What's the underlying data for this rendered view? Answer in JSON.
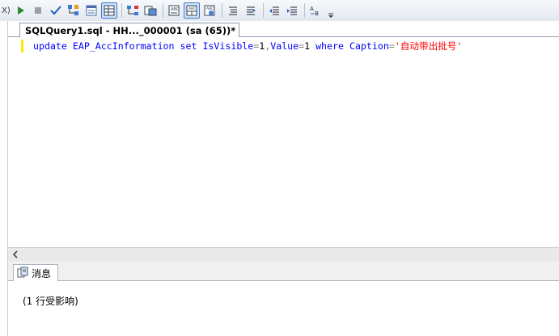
{
  "toolbar": {
    "partial_label": "X)",
    "buttons": [
      {
        "name": "execute-icon"
      },
      {
        "name": "stop-icon"
      },
      {
        "name": "parse-check-icon"
      },
      {
        "name": "display-estimated-plan-icon"
      },
      {
        "name": "query-designer-icon"
      },
      {
        "name": "results-to-grid-icon",
        "active": true
      },
      {
        "name": "include-actual-plan-icon"
      },
      {
        "name": "client-statistics-icon"
      },
      {
        "name": "results-to-text-icon"
      },
      {
        "name": "results-to-grid-2-icon",
        "active": true
      },
      {
        "name": "results-to-file-icon"
      },
      {
        "name": "comment-lines-icon"
      },
      {
        "name": "uncomment-lines-icon"
      },
      {
        "name": "decrease-indent-icon"
      },
      {
        "name": "increase-indent-icon"
      },
      {
        "name": "specify-template-values-icon"
      }
    ]
  },
  "editor": {
    "tab_title": "SQLQuery1.sql - HH..._000001 (sa (65))*",
    "code": {
      "t1": "update",
      "t2": "EAP_AccInformation",
      "t3": "set",
      "t4": "IsVisible",
      "t5": "=",
      "t6": "1",
      "t7": ",",
      "t8": "Value",
      "t9": "=",
      "t10": "1",
      "t11": "where",
      "t12": "Caption",
      "t13": "=",
      "t14": "'自动带出批号'"
    }
  },
  "results": {
    "tab_label": "消息",
    "message": "(1 行受影响)"
  },
  "colors": {
    "keyword": "#0000ff",
    "string": "#ff0000",
    "operator": "#808080",
    "line_marker": "#ffe600"
  }
}
